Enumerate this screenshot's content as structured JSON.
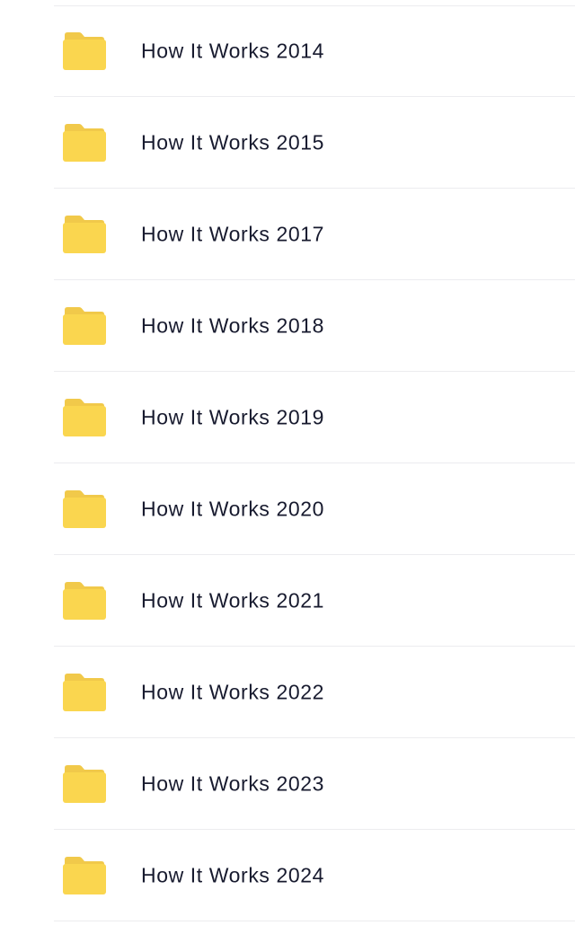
{
  "folders": [
    {
      "name": "How It Works 2014",
      "icon": "folder-icon"
    },
    {
      "name": "How It Works 2015",
      "icon": "folder-icon"
    },
    {
      "name": "How It Works 2017",
      "icon": "folder-icon"
    },
    {
      "name": "How It Works 2018",
      "icon": "folder-icon"
    },
    {
      "name": "How It Works 2019",
      "icon": "folder-icon"
    },
    {
      "name": "How It Works 2020",
      "icon": "folder-icon"
    },
    {
      "name": "How It Works 2021",
      "icon": "folder-icon"
    },
    {
      "name": "How It Works 2022",
      "icon": "folder-icon"
    },
    {
      "name": "How It Works 2023",
      "icon": "folder-icon"
    },
    {
      "name": "How It Works 2024",
      "icon": "folder-icon"
    }
  ],
  "colors": {
    "folder_back": "#f1c94a",
    "folder_front": "#fad64f",
    "text": "#171a2e",
    "divider": "#ececef"
  }
}
